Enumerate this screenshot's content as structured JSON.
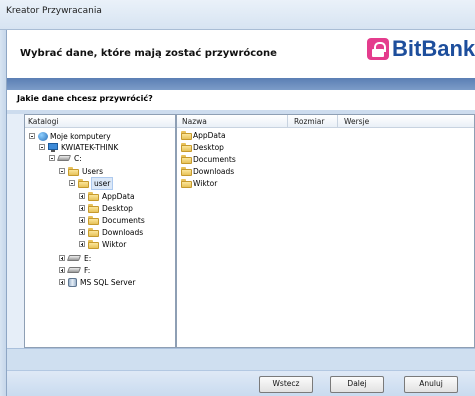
{
  "window": {
    "title": "Kreator Przywracania"
  },
  "header": {
    "heading": "Wybrać dane, które mają zostać przywrócone",
    "brand": "BitBank"
  },
  "question": "Jakie dane chcesz przywrócić?",
  "left_panel": {
    "header": "Katalogi"
  },
  "tree": {
    "root": "Moje komputery",
    "computer": "KWIATEK-THINK",
    "drive_c": "C:",
    "users": "Users",
    "user": "user",
    "children": [
      "AppData",
      "Desktop",
      "Documents",
      "Downloads",
      "Wiktor"
    ],
    "drive_e": "E:",
    "drive_f": "F:",
    "sql": "MS SQL Server"
  },
  "right_panel": {
    "columns": [
      "Nazwa",
      "Rozmiar",
      "Wersje"
    ],
    "items": [
      "AppData",
      "Desktop",
      "Documents",
      "Downloads",
      "Wiktor"
    ]
  },
  "buttons": {
    "back": "Wstecz",
    "next": "Dalej",
    "cancel": "Anuluj"
  },
  "colors": {
    "brand_pink": "#e43c8d",
    "brand_blue": "#1d4e9c",
    "band_blue": "#5b7fb4"
  }
}
